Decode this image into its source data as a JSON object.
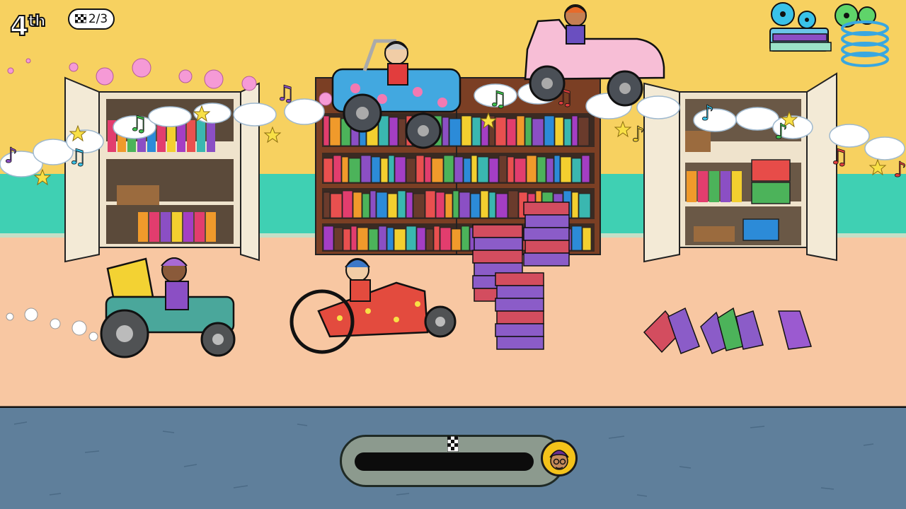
{
  "hud": {
    "position_number": "4",
    "position_suffix": "th",
    "lap_text": "2/3",
    "left_button_icon": "film-reel-books-icon",
    "right_button_icon": "film-reel-spring-icon"
  },
  "race_progress": {
    "fraction_filled": 0.96,
    "finish_icon": "checkered-flag-icon",
    "player_avatar_icon": "player-avatar-icon"
  },
  "scene": {
    "track_color": "#f9c9a3",
    "wall_color": "#f6cf5e",
    "stripe_color": "#3ecfb2",
    "floor_color": "#5e7f99"
  }
}
